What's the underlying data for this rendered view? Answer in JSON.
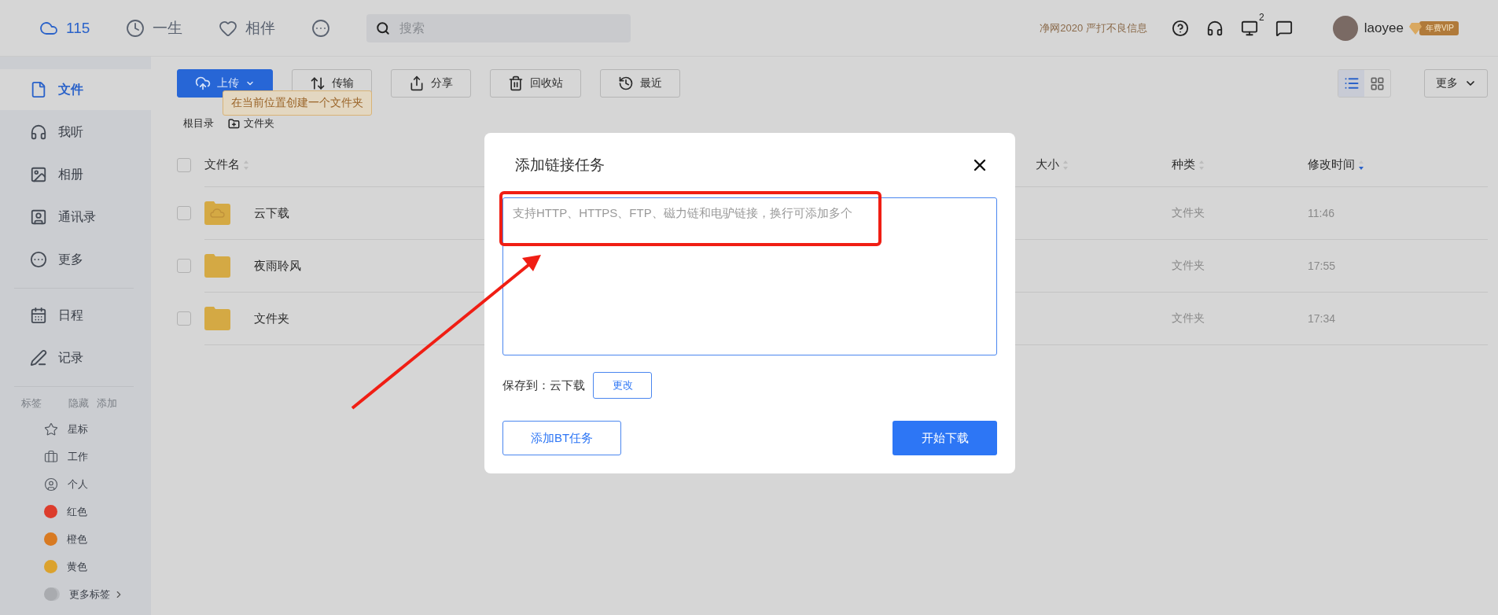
{
  "top_nav": {
    "items": [
      {
        "label": "115",
        "kind": "cloud",
        "selected": true
      },
      {
        "label": "一生",
        "kind": "clock",
        "selected": false
      },
      {
        "label": "相伴",
        "kind": "heart",
        "selected": false
      }
    ],
    "search": {
      "placeholder": "搜索"
    },
    "notice": "净网2020 严打不良信息",
    "device_badge": "2",
    "user": {
      "name": "laoyee",
      "badge": "年费VIP"
    }
  },
  "sidebar": {
    "nav": [
      {
        "label": "文件",
        "kind": "file",
        "selected": true
      },
      {
        "label": "我听",
        "kind": "headphones",
        "selected": false
      },
      {
        "label": "相册",
        "kind": "image",
        "selected": false
      },
      {
        "label": "通讯录",
        "kind": "contact",
        "selected": false
      },
      {
        "label": "更多",
        "kind": "more",
        "selected": false
      }
    ],
    "nav2": [
      {
        "label": "日程",
        "kind": "calendar",
        "selected": false
      },
      {
        "label": "记录",
        "kind": "note",
        "selected": false
      }
    ],
    "tags_header": {
      "title": "标签",
      "actions": [
        "隐藏",
        "添加"
      ]
    },
    "tags": [
      {
        "label": "星标",
        "kind": "star"
      },
      {
        "label": "工作",
        "kind": "work"
      },
      {
        "label": "个人",
        "kind": "person"
      },
      {
        "label": "红色",
        "kind": "color",
        "color": "#dc3c2c"
      },
      {
        "label": "橙色",
        "kind": "color",
        "color": "#d87a22"
      },
      {
        "label": "黄色",
        "kind": "color",
        "color": "#dba22e"
      },
      {
        "label": "更多标签",
        "kind": "more"
      }
    ]
  },
  "toolbar": {
    "buttons": [
      {
        "label": "上传",
        "kind": "upload"
      },
      {
        "label": "传输",
        "kind": "transfer"
      },
      {
        "label": "分享",
        "kind": "share"
      },
      {
        "label": "回收站",
        "kind": "trash"
      },
      {
        "label": "最近",
        "kind": "recent"
      }
    ],
    "tooltip": "在当前位置创建一个文件夹",
    "view_modes": [
      {
        "kind": "list",
        "selected": true
      },
      {
        "kind": "grid",
        "selected": false
      }
    ],
    "more": "更多"
  },
  "breadcrumb": {
    "root": "根目录",
    "new_folder": "文件夹"
  },
  "table": {
    "select_all": {
      "checked": false
    },
    "columns": [
      {
        "label": "文件名",
        "sorted": false
      },
      {
        "label": "大小",
        "sorted": false
      },
      {
        "label": "种类",
        "sorted": false
      },
      {
        "label": "修改时间",
        "sorted": true
      }
    ],
    "rows": [
      {
        "name": "云下载",
        "kind": "cloud",
        "type": "文件夹",
        "time": "11:46",
        "selected": false
      },
      {
        "name": "夜雨聆风",
        "kind": "folder",
        "type": "文件夹",
        "time": "17:55",
        "selected": false
      },
      {
        "name": "文件夹",
        "kind": "folder",
        "type": "文件夹",
        "time": "17:34",
        "selected": false
      }
    ]
  },
  "dialog": {
    "title": "添加链接任务",
    "placeholder": "支持HTTP、HTTPS、FTP、磁力链和电驴链接，换行可添加多个",
    "save_label": "保存到：",
    "save_folder": "云下载",
    "change": "更改",
    "bt_button": "添加BT任务",
    "start_button": "开始下载"
  }
}
